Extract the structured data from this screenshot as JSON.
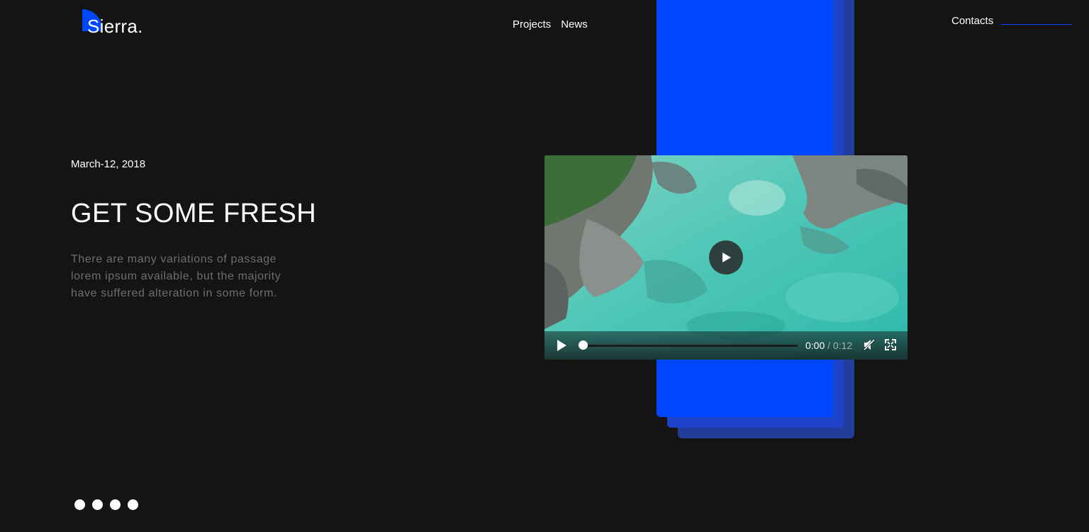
{
  "brand": {
    "name": "Sierra.",
    "accent_color": "#0048ff",
    "background_color": "#141414"
  },
  "nav": {
    "items": [
      {
        "label": "Projects"
      },
      {
        "label": "News"
      }
    ],
    "contacts_label": "Contacts"
  },
  "hero": {
    "date": "March-12, 2018",
    "headline": "GET SOME FRESH",
    "description": "There are many variations of passage lorem ipsum available, but the majority have suffered alteration in some form."
  },
  "video": {
    "current_time": "0:00",
    "separator": "/",
    "duration": "0:12",
    "progress": 0,
    "icons": {
      "big_play": "play-icon",
      "play": "play-icon",
      "mute": "muted-speaker-icon",
      "fullscreen": "fullscreen-icon"
    }
  },
  "pager": {
    "count": 4,
    "active_index": 0
  }
}
